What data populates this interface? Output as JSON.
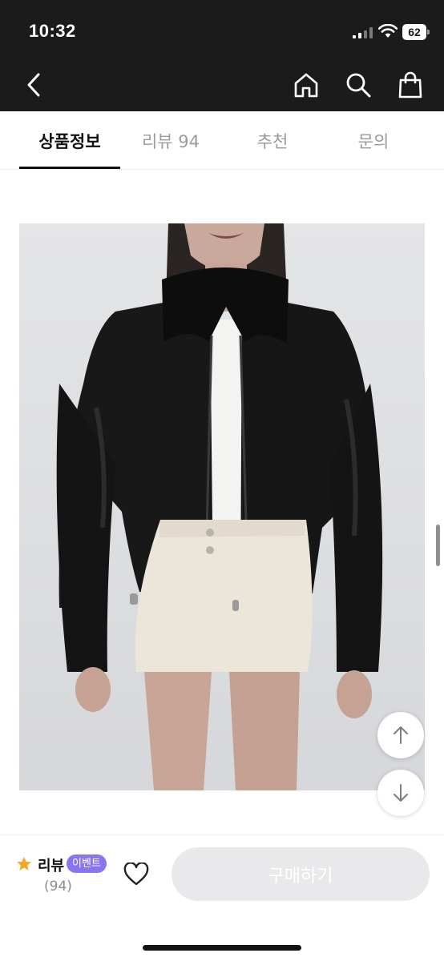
{
  "status_bar": {
    "time": "10:32",
    "battery": "62"
  },
  "nav": {
    "back_icon": "chevron-left-icon",
    "home_icon": "home-icon",
    "search_icon": "search-icon",
    "cart_icon": "shopping-bag-icon"
  },
  "tabs": [
    {
      "label": "상품정보",
      "active": true
    },
    {
      "label": "리뷰 94",
      "active": false
    },
    {
      "label": "추천",
      "active": false
    },
    {
      "label": "문의",
      "active": false
    }
  ],
  "product_image": {
    "description_icon": "product-photo"
  },
  "floating": {
    "up_icon": "arrow-up-icon",
    "down_icon": "arrow-down-icon"
  },
  "bottom_bar": {
    "review_label": "리뷰",
    "event_badge": "이벤트",
    "review_count": "(94)",
    "buy_label": "구매하기",
    "star_color": "#f5a623",
    "badge_color": "#8a74f0"
  }
}
